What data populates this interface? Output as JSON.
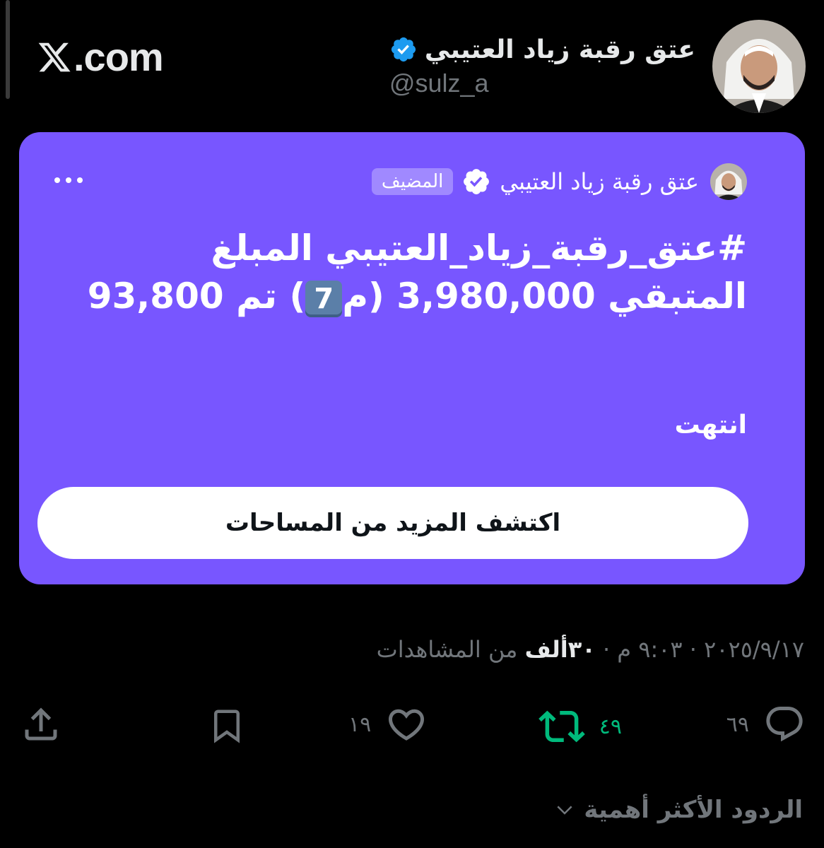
{
  "brand": {
    "domain": ".com"
  },
  "author": {
    "display_name": "عتق رقبة زياد العتيبي",
    "handle": "@sulz_a"
  },
  "space": {
    "host_name": "عتق رقبة زياد العتيبي",
    "host_badge": "المضيف",
    "title_line1": "#عتق_رقبة_زياد_العتيبي المبلغ",
    "title_line2_part1": "المتبقي 3,980,000 (م",
    "title_keycap": "7",
    "title_line2_part2": ") تم 93,800",
    "status": "انتهت",
    "explore_button_label": "اكتشف المزيد من المساحات"
  },
  "meta": {
    "date": "٢٠٢٥/٩/١٧",
    "separator": "·",
    "time": "٩:٠٣ م",
    "views_count": "٣٠ألف",
    "views_label": "من المشاهدات"
  },
  "actions": {
    "replies_count": "٦٩",
    "reposts_count": "٤٩",
    "likes_count": "١٩"
  },
  "replies_sort": {
    "label": "الردود الأكثر أهمية"
  },
  "colors": {
    "background": "#000000",
    "card": "#7856ff",
    "verified": "#1d9bf0",
    "muted": "#71767b",
    "repost_green": "#00ba7c"
  }
}
